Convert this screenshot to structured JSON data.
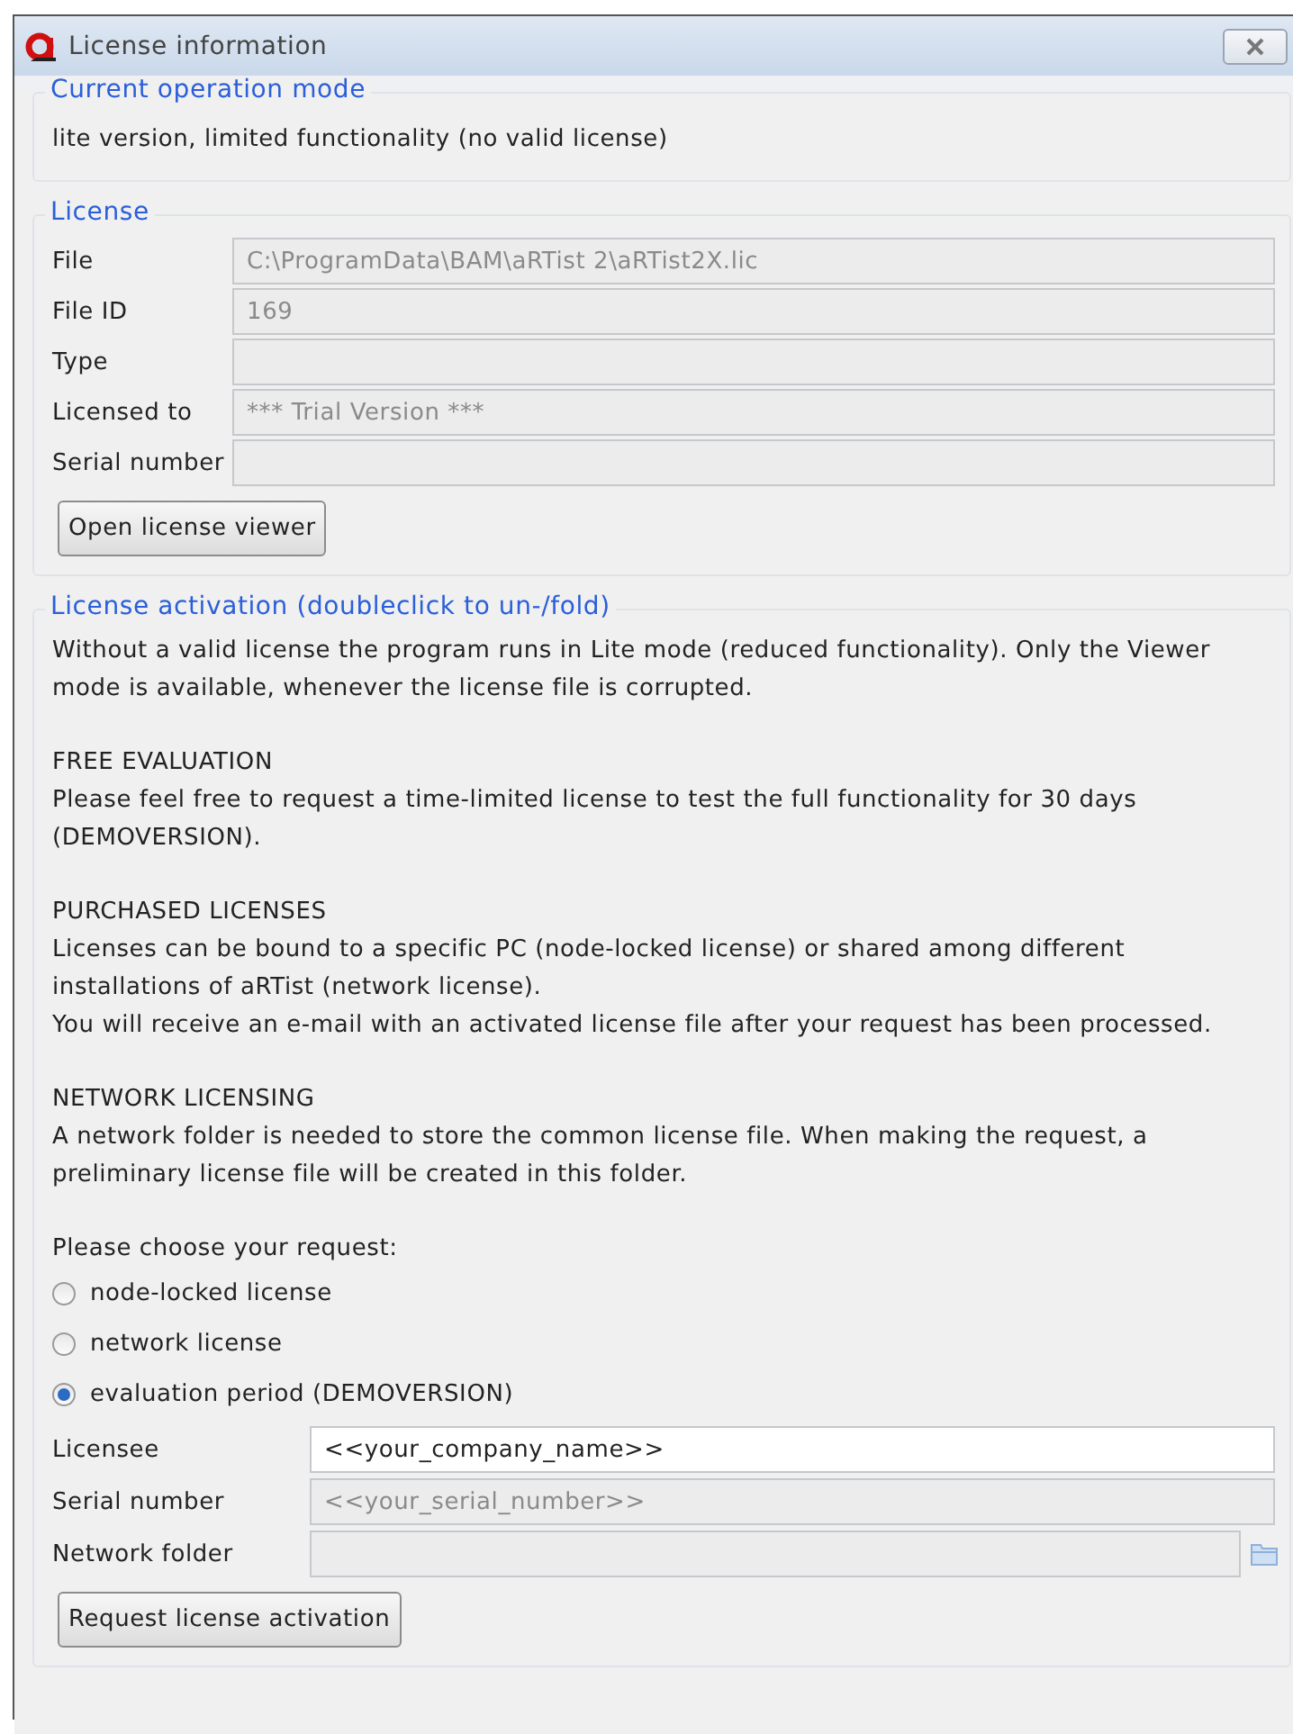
{
  "window": {
    "title": "License information"
  },
  "operation_mode": {
    "legend": "Current operation mode",
    "text": "lite version, limited functionality (no valid license)"
  },
  "license": {
    "legend": "License",
    "fields": [
      {
        "label": "File",
        "value": "C:\\ProgramData\\BAM\\aRTist 2\\aRTist2X.lic"
      },
      {
        "label": "File ID",
        "value": "169"
      },
      {
        "label": "Type"
      },
      {
        "label": "Licensed to",
        "value": "*** Trial Version ***"
      },
      {
        "label": "Serial number"
      }
    ],
    "button": "Open license viewer"
  },
  "activation": {
    "legend": "License activation (doubleclick to un-/fold)",
    "intro": "Without a valid license the program runs in Lite mode (reduced functionality). Only the Viewer mode is available, whenever the license file is corrupted.",
    "sections": [
      {
        "heading": "FREE EVALUATION",
        "paragraphs": [
          "Please feel free to request a time-limited license to test the full functionality for 30 days (DEMOVERSION)."
        ]
      },
      {
        "heading": "PURCHASED LICENSES",
        "paragraphs": [
          "Licenses can be bound to a specific PC (node-locked license) or shared among different installations of aRTist (network license).",
          "You will receive an e-mail with an activated license file after your request has been processed."
        ]
      },
      {
        "heading": "NETWORK LICENSING",
        "paragraphs": [
          "A network folder is needed to store the common license file. When making the request, a preliminary license file will be created in this folder."
        ]
      }
    ],
    "prompt": "Please choose your request:",
    "options": [
      {
        "label": "node-locked license",
        "selected": false
      },
      {
        "label": "network license",
        "selected": false
      },
      {
        "label": "evaluation period (DEMOVERSION)",
        "selected": true
      }
    ],
    "fields": [
      {
        "label": "Licensee",
        "value": "<<your_company_name>>",
        "disabled": false
      },
      {
        "label": "Serial number",
        "value": "<<your_serial_number>>",
        "disabled": true
      },
      {
        "label": "Network folder",
        "disabled": true,
        "kind": "folder"
      }
    ],
    "button": "Request license activation"
  }
}
